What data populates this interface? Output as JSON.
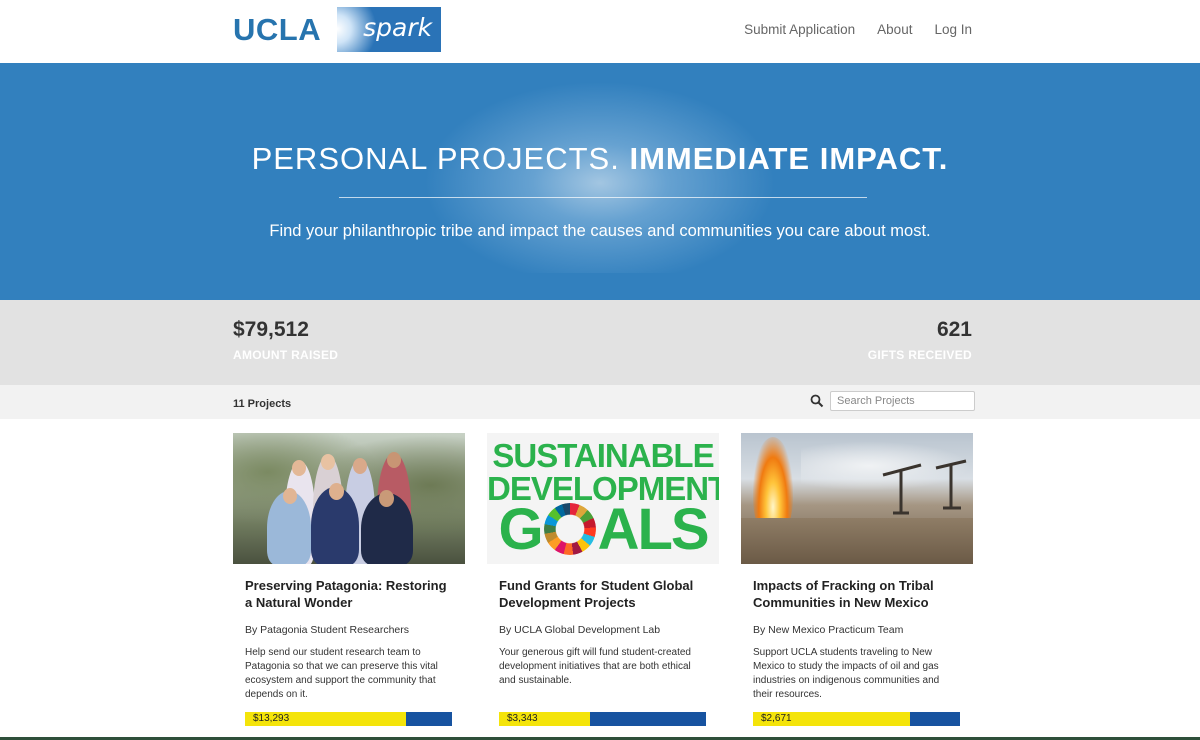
{
  "header": {
    "logo_ucla": "UCLA",
    "logo_spark": "spark",
    "nav": [
      "Submit Application",
      "About",
      "Log In"
    ]
  },
  "hero": {
    "title_light": "PERSONAL PROJECTS.",
    "title_bold": "IMMEDIATE IMPACT.",
    "subtitle": "Find your philanthropic tribe and impact the causes and communities you care about most."
  },
  "stats": {
    "amount_raised": "$79,512",
    "amount_raised_label": "AMOUNT RAISED",
    "gifts_received": "621",
    "gifts_received_label": "GIFTS RECEIVED"
  },
  "toolbar": {
    "count": "11 Projects",
    "search_placeholder": "Search Projects"
  },
  "cards": [
    {
      "title": "Preserving Patagonia: Restoring a Natural Wonder",
      "by": "By Patagonia Student Researchers",
      "description": "Help send our student research team to Patagonia so that we can preserve this vital ecosystem and support the community that depends on it.",
      "amount": "$13,293",
      "progress": 0.78
    },
    {
      "title": "Fund Grants for Student Global Development Projects",
      "by": "By UCLA Global Development Lab",
      "description": "Your generous gift will fund student-created development initiatives that are both ethical and sustainable.",
      "amount": "$3,343",
      "progress": 0.44,
      "image_text": [
        "SUSTAINABLE",
        "DEVELOPMENT",
        "G",
        "ALS"
      ]
    },
    {
      "title": "Impacts of Fracking on Tribal Communities in New Mexico",
      "by": "By New Mexico Practicum Team",
      "description": "Support UCLA students traveling to New Mexico to study the impacts of oil and gas industries on indigenous communities and their resources.",
      "amount": "$2,671",
      "progress": 0.76
    }
  ],
  "colors": {
    "brand_blue": "#2774ae",
    "hero_blue": "#3280be",
    "progress_yellow": "#f4e40a",
    "progress_blue": "#1753a0",
    "sdg_green": "#2bb24c"
  }
}
